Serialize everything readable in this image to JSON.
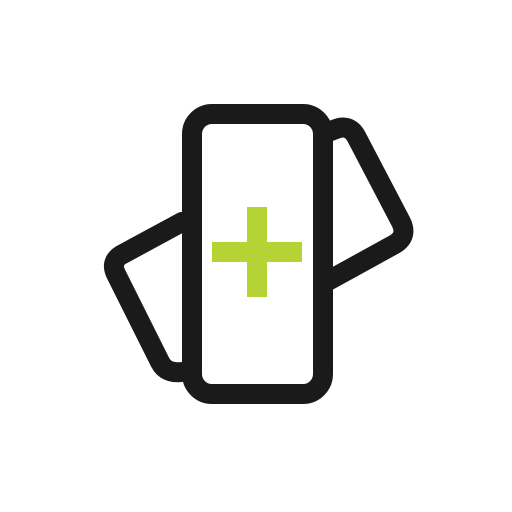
{
  "icon": {
    "name": "rotate-device-add-icon",
    "colors": {
      "outline": "#1a1a1a",
      "accent": "#b5d334",
      "background": "#ffffff"
    }
  }
}
